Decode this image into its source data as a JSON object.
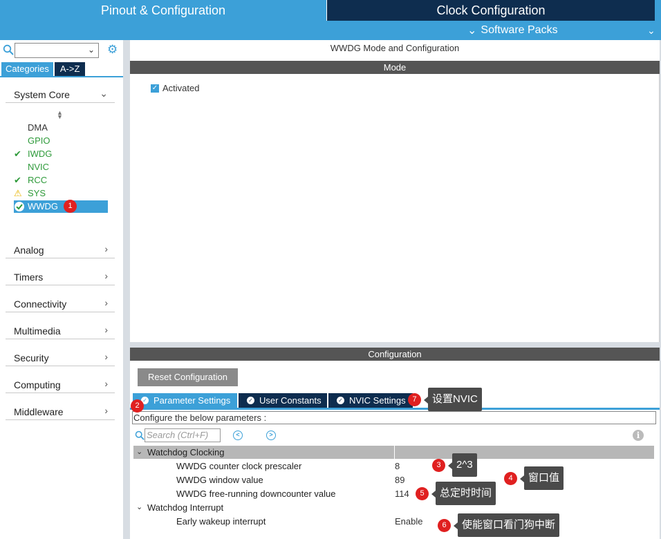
{
  "top_tabs": {
    "pinout": "Pinout & Configuration",
    "clock": "Clock Configuration",
    "software_packs": "Software Packs"
  },
  "sidebar": {
    "search_value": "",
    "tabs": {
      "categories": "Categories",
      "az": "A->Z"
    },
    "system_core": "System Core",
    "peripherals": [
      {
        "name": "DMA",
        "status": "none"
      },
      {
        "name": "GPIO",
        "status": "none"
      },
      {
        "name": "IWDG",
        "status": "check"
      },
      {
        "name": "NVIC",
        "status": "none"
      },
      {
        "name": "RCC",
        "status": "check"
      },
      {
        "name": "SYS",
        "status": "warning"
      },
      {
        "name": "WWDG",
        "status": "selected"
      }
    ],
    "categories": [
      "Analog",
      "Timers",
      "Connectivity",
      "Multimedia",
      "Security",
      "Computing",
      "Middleware"
    ]
  },
  "mode": {
    "title": "WWDG Mode and Configuration",
    "bar": "Mode",
    "activated_label": "Activated"
  },
  "config": {
    "bar": "Configuration",
    "reset_label": "Reset Configuration",
    "tabs": {
      "params": "Parameter Settings",
      "consts": "User Constants",
      "nvic": "NVIC Settings"
    },
    "configure_text": "Configure the below parameters :",
    "search_placeholder": "Search (Ctrl+F)",
    "groups": {
      "clocking": "Watchdog Clocking",
      "interrupt": "Watchdog Interrupt"
    },
    "params": [
      {
        "label": "WWDG counter clock prescaler",
        "value": "8"
      },
      {
        "label": "WWDG window value",
        "value": "89"
      },
      {
        "label": "WWDG free-running downcounter value",
        "value": "114"
      },
      {
        "label": "Early wakeup interrupt",
        "value": "Enable"
      }
    ]
  },
  "annotations": {
    "b1": "1",
    "b2": "2",
    "b3": "3",
    "b4": "4",
    "b5": "5",
    "b6": "6",
    "b7": "7",
    "t3": "2^3",
    "t4": "窗口值",
    "t5": "总定时时间",
    "t6": "使能窗口看门狗中断",
    "t7": "设置NVIC"
  },
  "colors": {
    "accent": "#3ca0d8",
    "dark_navy": "#0e2d4f",
    "green": "#2e9a3a",
    "badge_red": "#e02020"
  }
}
